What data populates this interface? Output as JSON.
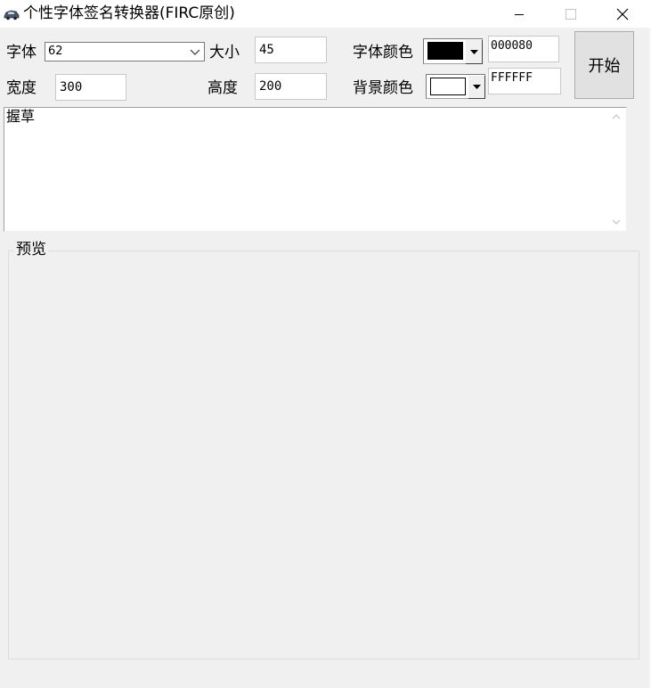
{
  "window": {
    "title": "个性字体签名转换器(FIRC原创)",
    "icon": "car-icon",
    "controls": {
      "minimize": "minimize-icon",
      "maximize": "maximize-icon",
      "close": "close-icon"
    }
  },
  "form": {
    "font": {
      "label": "字体",
      "value": "62"
    },
    "size": {
      "label": "大小",
      "value": "45"
    },
    "width": {
      "label": "宽度",
      "value": "300"
    },
    "height": {
      "label": "高度",
      "value": "200"
    },
    "font_color": {
      "label": "字体颜色",
      "swatch": "#000000",
      "hex": "000080"
    },
    "bg_color": {
      "label": "背景颜色",
      "swatch": "#ffffff",
      "hex": "FFFFFF"
    },
    "start_label": "开始"
  },
  "text_input": {
    "value": "握草"
  },
  "preview": {
    "label": "预览"
  }
}
